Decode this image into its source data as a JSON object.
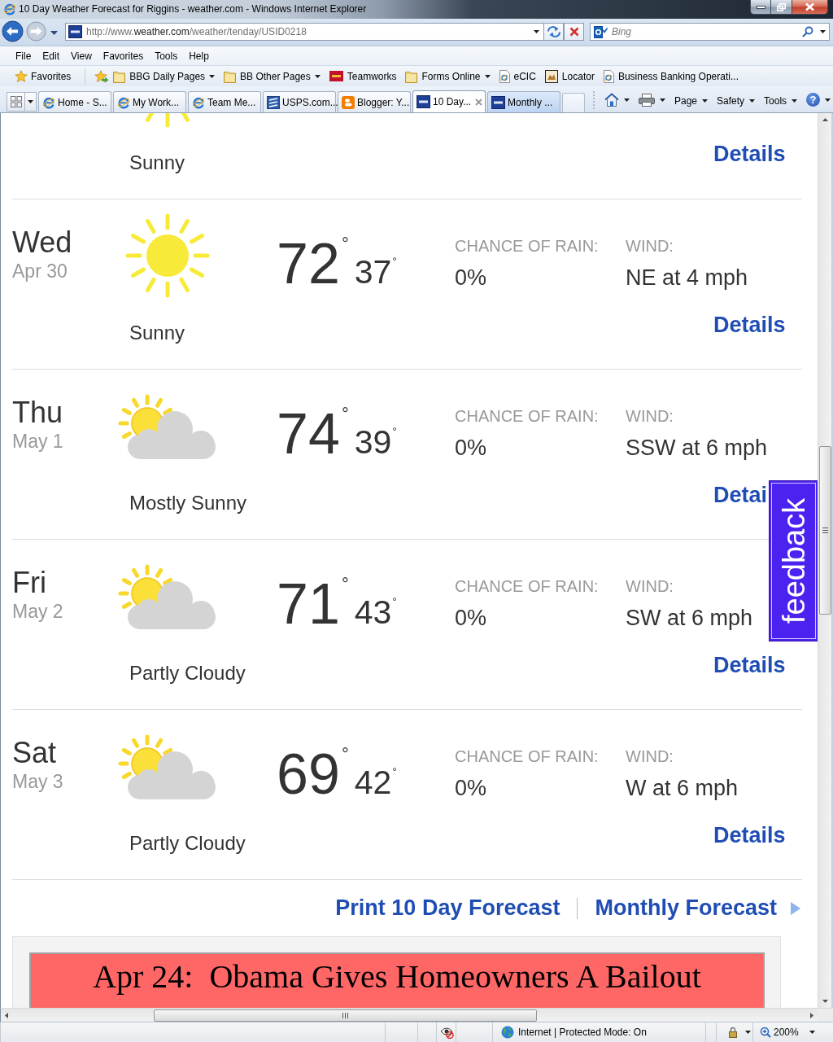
{
  "window": {
    "title": "10 Day Weather Forecast for Riggins - weather.com - Windows Internet Explorer"
  },
  "address_bar": {
    "url_prefix": "http://www.",
    "url_domain": "weather.com",
    "url_path": "/weather/tenday/USID0218"
  },
  "search": {
    "placeholder": "Bing"
  },
  "menu": [
    "File",
    "Edit",
    "View",
    "Favorites",
    "Tools",
    "Help"
  ],
  "favorites_bar": {
    "favorites_button": "Favorites",
    "links": [
      {
        "kind": "folder",
        "label": "BBG Daily Pages",
        "dropdown": true
      },
      {
        "kind": "folder",
        "label": "BB Other Pages",
        "dropdown": true
      },
      {
        "kind": "bank",
        "label": "Teamworks",
        "dropdown": false
      },
      {
        "kind": "folder",
        "label": "Forms Online",
        "dropdown": true
      },
      {
        "kind": "page",
        "label": "eCIC",
        "dropdown": false
      },
      {
        "kind": "image",
        "label": "Locator",
        "dropdown": false
      },
      {
        "kind": "page",
        "label": "Business Banking Operati...",
        "dropdown": false
      }
    ]
  },
  "tabs": [
    {
      "kind": "ie",
      "label": "Home - S...",
      "selected": false,
      "highlighted": false
    },
    {
      "kind": "ie",
      "label": "My Work...",
      "selected": false,
      "highlighted": false
    },
    {
      "kind": "ie",
      "label": "Team Me...",
      "selected": false,
      "highlighted": false
    },
    {
      "kind": "usps",
      "label": "USPS.com...",
      "selected": false,
      "highlighted": false
    },
    {
      "kind": "blogger",
      "label": "Blogger: Y...",
      "selected": false,
      "highlighted": false
    },
    {
      "kind": "twc",
      "label": "10 Day...",
      "selected": true,
      "highlighted": false
    },
    {
      "kind": "twc",
      "label": "Monthly ...",
      "selected": false,
      "highlighted": true
    }
  ],
  "command_bar": [
    {
      "kind": "home"
    },
    {
      "kind": "print"
    },
    {
      "kind": "menu",
      "label": "Page"
    },
    {
      "kind": "menu",
      "label": "Safety"
    },
    {
      "kind": "menu",
      "label": "Tools"
    },
    {
      "kind": "help",
      "glyph": "?"
    }
  ],
  "forecast": {
    "partial_day": {
      "kind": "sunny",
      "condition": "Sunny",
      "details": "Details"
    },
    "days": [
      {
        "day": "Wed",
        "date": "Apr 30",
        "kind": "sunny",
        "high": "72$^{°}$",
        "low": "37$^{°}$",
        "rain_label": "CHANCE OF RAIN:",
        "rain": "0%",
        "wind_label": "WIND:",
        "wind": "NE at 4 mph",
        "condition": "Sunny",
        "details": "Details"
      },
      {
        "day": "Thu",
        "date": "May 1",
        "kind": "mostly_sunny",
        "high": "74$^{°}$",
        "low": "39$^{°}$",
        "rain_label": "CHANCE OF RAIN:",
        "rain": "0%",
        "wind_label": "WIND:",
        "wind": "SSW at 6 mph",
        "condition": "Mostly Sunny",
        "details": "Detai"
      },
      {
        "day": "Fri",
        "date": "May 2",
        "kind": "partly_cloudy",
        "high": "71$^{°}$",
        "low": "43$^{°}$",
        "rain_label": "CHANCE OF RAIN:",
        "rain": "0%",
        "wind_label": "WIND:",
        "wind": "SW at 6 mph",
        "condition": "Partly Cloudy",
        "details": "Details"
      },
      {
        "day": "Sat",
        "date": "May 3",
        "kind": "partly_cloudy",
        "high": "69$^{°}$",
        "low": "42$^{°}$",
        "rain_label": "CHANCE OF RAIN:",
        "rain": "0%",
        "wind_label": "WIND:",
        "wind": "W at 6 mph",
        "condition": "Partly Cloudy",
        "details": "Details"
      }
    ]
  },
  "footer_links": [
    {
      "label": "Print 10 Day Forecast",
      "arrow": false
    },
    {
      "label": "Monthly Forecast",
      "arrow": true
    }
  ],
  "ad": {
    "headline": "Apr 24:  Obama Gives Homeowners A Bailout"
  },
  "feedback_tab": {
    "label": "feedback"
  },
  "status_bar": {
    "zone": "Internet | Protected Mode: On",
    "zoom": "200%"
  }
}
